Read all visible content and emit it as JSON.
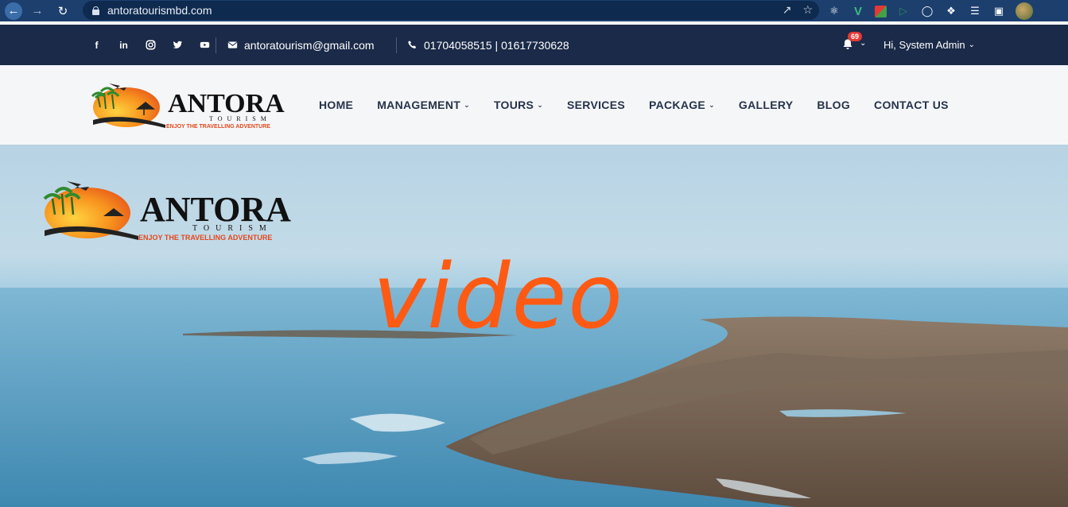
{
  "browser": {
    "url": "antoratourismbd.com"
  },
  "topbar": {
    "social": [
      "f",
      "in",
      "instagram",
      "twitter",
      "youtube"
    ],
    "email": "antoratourism@gmail.com",
    "phone": "01704058515 | 01617730628",
    "notification_count": "69",
    "user_greeting": "Hi, System Admin"
  },
  "brand": {
    "name": "ANTORA",
    "subname": "TOURISM",
    "tagline": "ENJOY THE TRAVELLING ADVENTURE"
  },
  "nav": {
    "items": [
      {
        "label": "HOME",
        "dropdown": false
      },
      {
        "label": "MANAGEMENT",
        "dropdown": true
      },
      {
        "label": "TOURS",
        "dropdown": true
      },
      {
        "label": "SERVICES",
        "dropdown": false
      },
      {
        "label": "PACKAGE",
        "dropdown": true
      },
      {
        "label": "GALLERY",
        "dropdown": false
      },
      {
        "label": "BLOG",
        "dropdown": false
      },
      {
        "label": "CONTACT US",
        "dropdown": false
      }
    ]
  },
  "hero": {
    "annotation": "video"
  },
  "colors": {
    "chrome": "#1c3f6e",
    "topbar": "#1a2a48",
    "header": "#f5f6f8",
    "nav_text": "#26324a",
    "scribble": "#ff5a14",
    "badge": "#e53935"
  }
}
